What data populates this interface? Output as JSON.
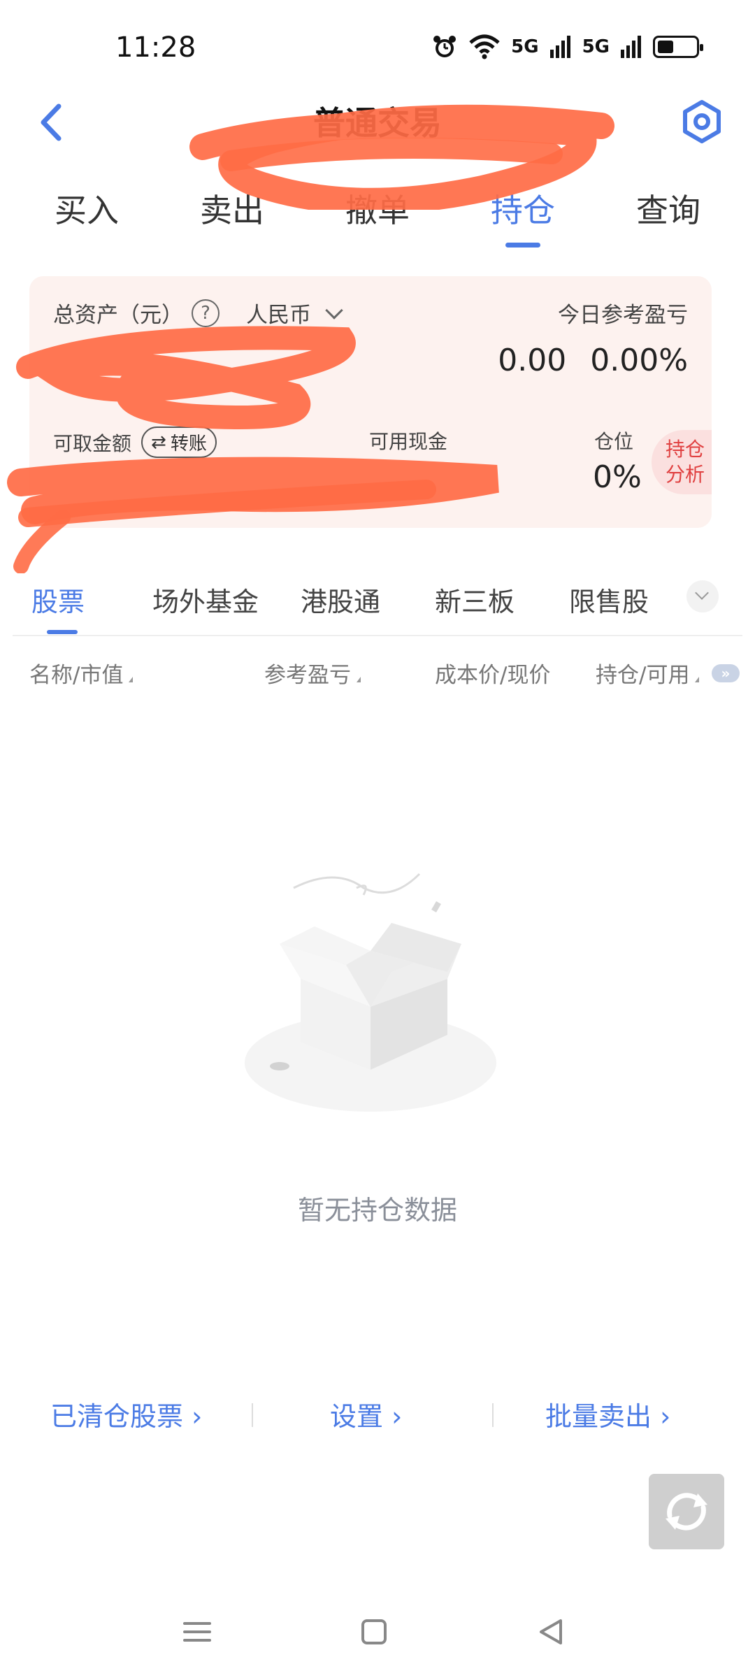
{
  "status_bar": {
    "time": "11:28",
    "signal1": "5G",
    "signal2": "5G"
  },
  "header": {
    "title": "普通交易"
  },
  "main_tabs": [
    {
      "label": "买入",
      "active": false
    },
    {
      "label": "卖出",
      "active": false
    },
    {
      "label": "撤单",
      "active": false
    },
    {
      "label": "持仓",
      "active": true
    },
    {
      "label": "查询",
      "active": false
    }
  ],
  "asset_card": {
    "total_assets_label": "总资产（元）",
    "help_icon": "?",
    "currency": "人民币",
    "today_pl_label": "今日参考盈亏",
    "today_pl_value": "0.00",
    "today_pl_percent": "0.00%",
    "withdrawable_label": "可取金额",
    "transfer_label": "转账",
    "available_cash_label": "可用现金",
    "position_ratio_label": "仓位",
    "position_ratio_value": "0%",
    "analysis_label_1": "持仓",
    "analysis_label_2": "分析"
  },
  "sub_tabs": [
    {
      "label": "股票",
      "active": true
    },
    {
      "label": "场外基金",
      "active": false
    },
    {
      "label": "港股通",
      "active": false
    },
    {
      "label": "新三板",
      "active": false
    },
    {
      "label": "限售股",
      "active": false
    }
  ],
  "columns": {
    "name_value": "名称/市值",
    "ref_pl": "参考盈亏",
    "cost_price": "成本价/现价",
    "position_available": "持仓/可用",
    "expand": "»"
  },
  "empty_state": {
    "message": "暂无持仓数据"
  },
  "bottom_links": {
    "cleared_stocks": "已清仓股票 ›",
    "settings": "设置 ›",
    "batch_sell": "批量卖出 ›"
  },
  "colors": {
    "accent": "#4b7be5",
    "card_bg": "#fdf2ef",
    "analysis_red": "#e04040",
    "scribble": "#ff6b45"
  },
  "icons": {
    "back": "back-arrow-icon",
    "settings": "hexagon-settings-icon",
    "refresh": "refresh-icon",
    "nav_menu": "menu-icon",
    "nav_home": "home-square-icon",
    "nav_back": "back-triangle-icon"
  }
}
